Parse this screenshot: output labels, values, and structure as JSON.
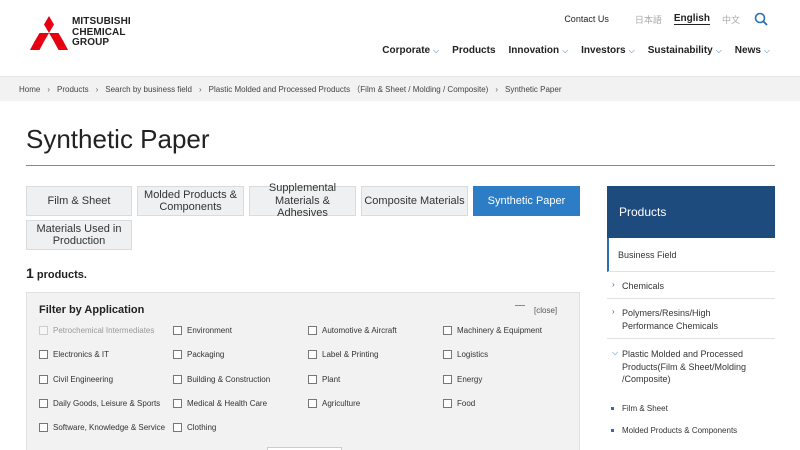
{
  "brand": {
    "logo_text": [
      "MITSUBISHI",
      "CHEMICAL",
      "GROUP"
    ],
    "logo_color": "#e60012"
  },
  "topnav": {
    "contact": "Contact Us",
    "lang_ja": "日本語",
    "lang_en": "English",
    "lang_zh": "中文"
  },
  "mainnav": [
    "Corporate",
    "Products",
    "Innovation",
    "Investors",
    "Sustainability",
    "News"
  ],
  "breadcrumb": [
    "Home",
    "Products",
    "Search by business field",
    "Plastic Molded and Processed Products （Film & Sheet / Molding / Composite)",
    "Synthetic Paper"
  ],
  "page_title": "Synthetic Paper",
  "tabs": [
    "Film & Sheet",
    "Molded Products & Components",
    "Supplemental Materials & Adhesives",
    "Composite Materials",
    "Synthetic Paper",
    "Materials Used in Production"
  ],
  "count": {
    "number": "1",
    "label": " products."
  },
  "filter": {
    "title": "Filter by Application",
    "close": "[close]",
    "options": [
      "Petrochemical Intermediates",
      "Environment",
      "Automotive & Aircraft",
      "Machinery & Equipment",
      "Electronics & IT",
      "Packaging",
      "Label & Printing",
      "Logistics",
      "Civil Engineering",
      "Building & Construction",
      "Plant",
      "Energy",
      "Daily Goods, Leisure & Sports",
      "Medical & Health Care",
      "Agriculture",
      "Food",
      "Software, Knowledge & Service",
      "Clothing"
    ]
  },
  "sidebar": {
    "header": "Products",
    "business_field": "Business Field",
    "items": [
      "Chemicals",
      "Polymers/Resins/High Performance Chemicals",
      "Plastic Molded and Processed Products(Film & Sheet/Molding /Composite)"
    ],
    "sub_items": [
      "Film & Sheet",
      "Molded Products & Components"
    ]
  },
  "colors": {
    "accent": "#2c7dc6",
    "sidebar_head": "#1d4b7e"
  }
}
